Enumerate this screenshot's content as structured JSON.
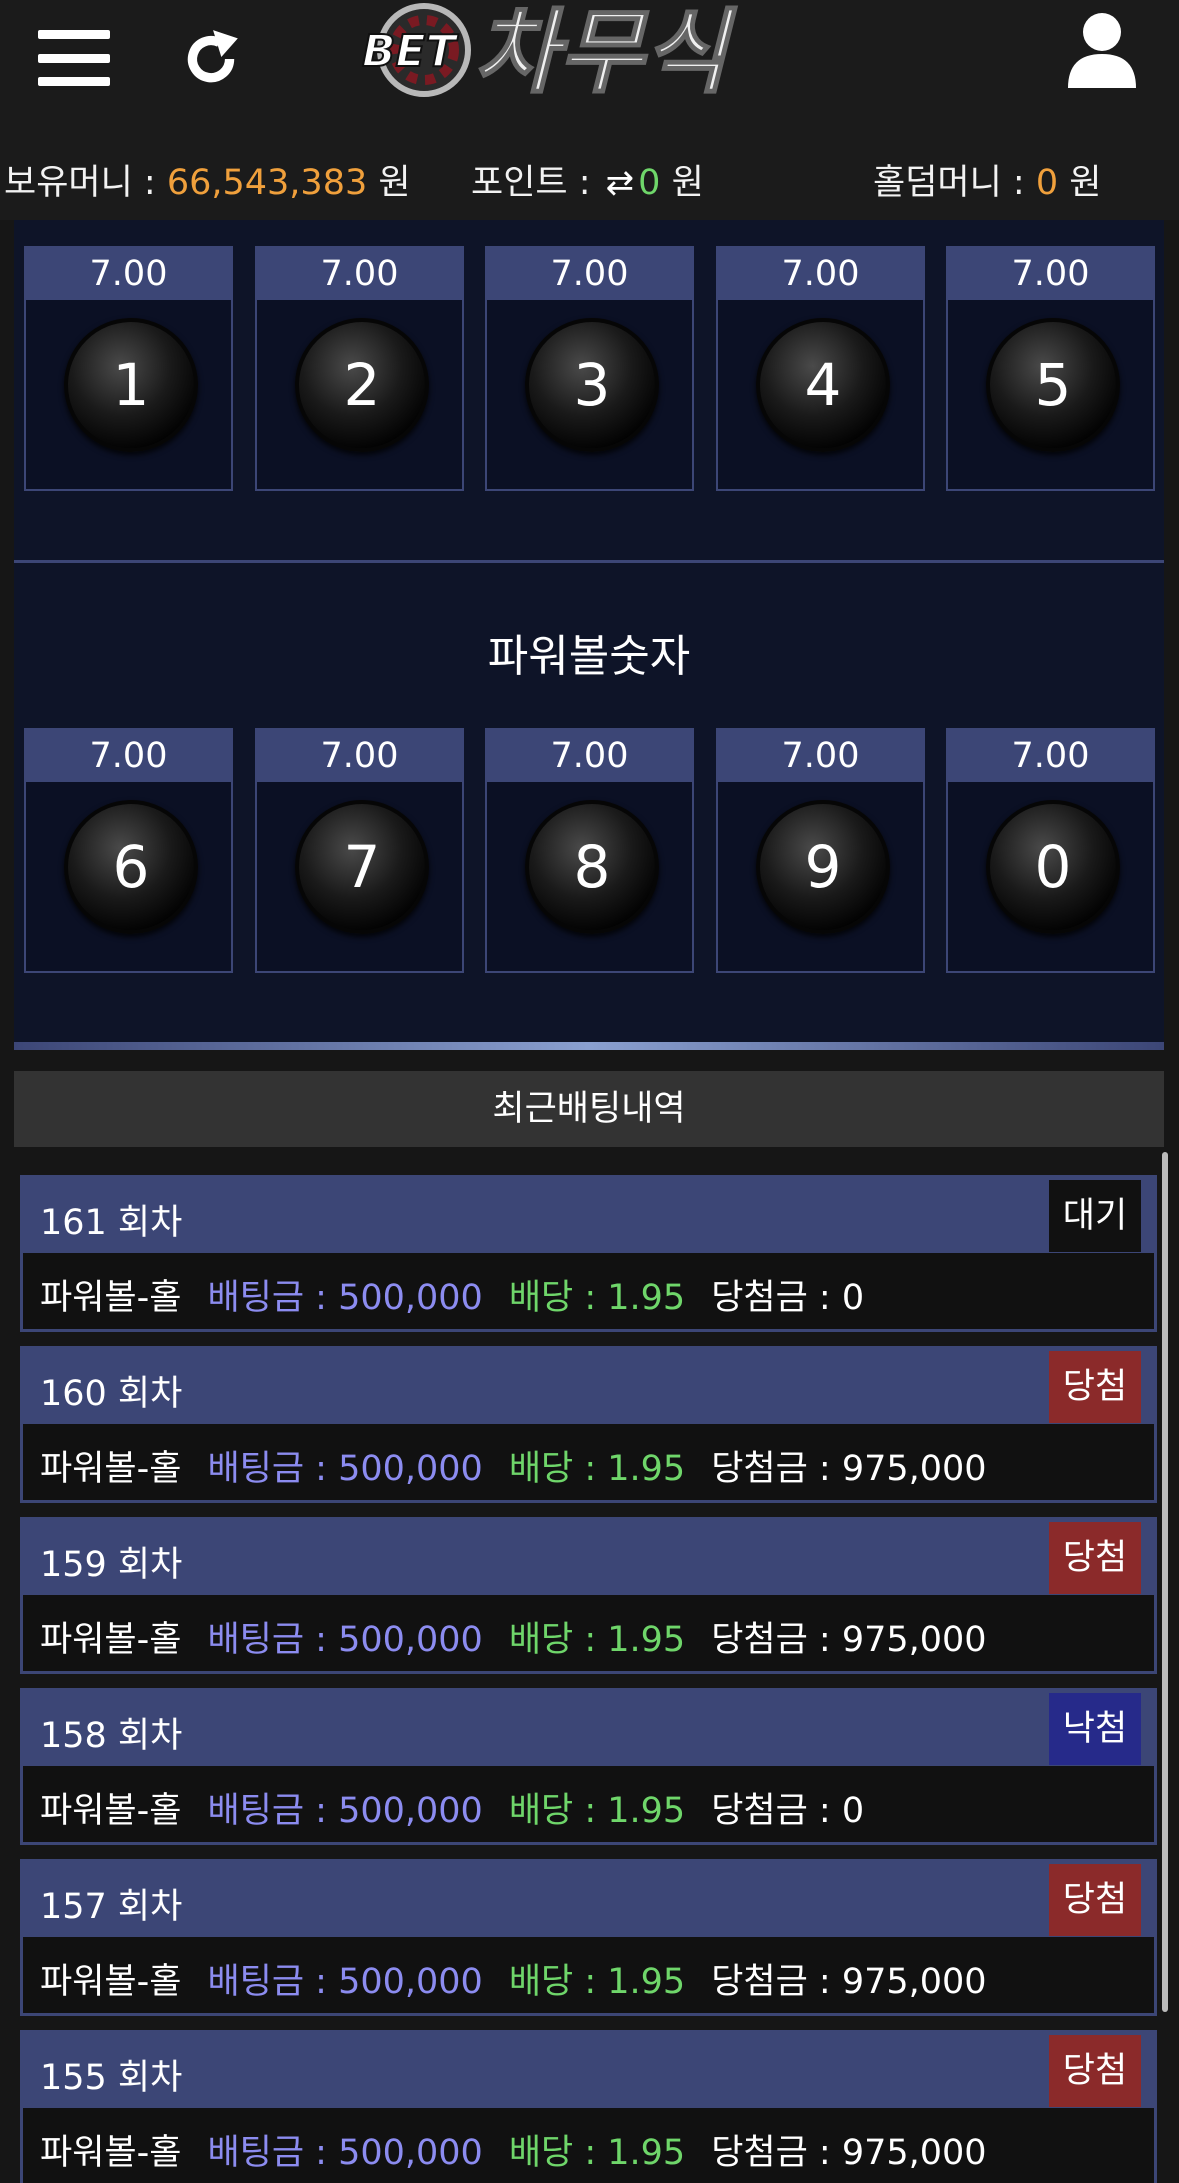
{
  "header": {
    "logo_prefix": "BET",
    "logo_title": "차무식",
    "icons": [
      "menu-icon",
      "refresh-icon",
      "user-icon"
    ]
  },
  "balances": {
    "holding_label": "보유머니 : ",
    "holding_value": "66,543,383",
    "holding_unit": " 원",
    "points_label": "포인트 : ",
    "points_value": "0",
    "points_unit": " 원",
    "holdem_label": "홀덤머니 : ",
    "holdem_value": "0",
    "holdem_unit": " 원"
  },
  "powerball_numbers_top": [
    {
      "odds": "7.00",
      "number": "1"
    },
    {
      "odds": "7.00",
      "number": "2"
    },
    {
      "odds": "7.00",
      "number": "3"
    },
    {
      "odds": "7.00",
      "number": "4"
    },
    {
      "odds": "7.00",
      "number": "5"
    }
  ],
  "section_title": "파워볼숫자",
  "powerball_numbers_bottom": [
    {
      "odds": "7.00",
      "number": "6"
    },
    {
      "odds": "7.00",
      "number": "7"
    },
    {
      "odds": "7.00",
      "number": "8"
    },
    {
      "odds": "7.00",
      "number": "9"
    },
    {
      "odds": "7.00",
      "number": "0"
    }
  ],
  "recent_bets_title": "최근배팅내역",
  "bets": [
    {
      "round": "161 회차",
      "status": "대기",
      "game": "파워볼-홀",
      "amount": "배팅금 : 500,000",
      "odds": "배당 : 1.95",
      "prize": "당첨금 : 0"
    },
    {
      "round": "160 회차",
      "status": "당첨",
      "game": "파워볼-홀",
      "amount": "배팅금 : 500,000",
      "odds": "배당 : 1.95",
      "prize": "당첨금 : 975,000"
    },
    {
      "round": "159 회차",
      "status": "당첨",
      "game": "파워볼-홀",
      "amount": "배팅금 : 500,000",
      "odds": "배당 : 1.95",
      "prize": "당첨금 : 975,000"
    },
    {
      "round": "158 회차",
      "status": "낙첨",
      "game": "파워볼-홀",
      "amount": "배팅금 : 500,000",
      "odds": "배당 : 1.95",
      "prize": "당첨금 : 0"
    },
    {
      "round": "157 회차",
      "status": "당첨",
      "game": "파워볼-홀",
      "amount": "배팅금 : 500,000",
      "odds": "배당 : 1.95",
      "prize": "당첨금 : 975,000"
    },
    {
      "round": "155 회차",
      "status": "당첨",
      "game": "파워볼-홀",
      "amount": "배팅금 : 500,000",
      "odds": "배당 : 1.95",
      "prize": "당첨금 : 975,000"
    }
  ],
  "colors": {
    "accent_orange": "#f0a03c",
    "accent_green": "#6fd66a",
    "bet_amount": "#8c8cf0",
    "win_badge": "#8b2a2a",
    "lose_badge": "#262a8a",
    "card_border": "#3c4676"
  }
}
